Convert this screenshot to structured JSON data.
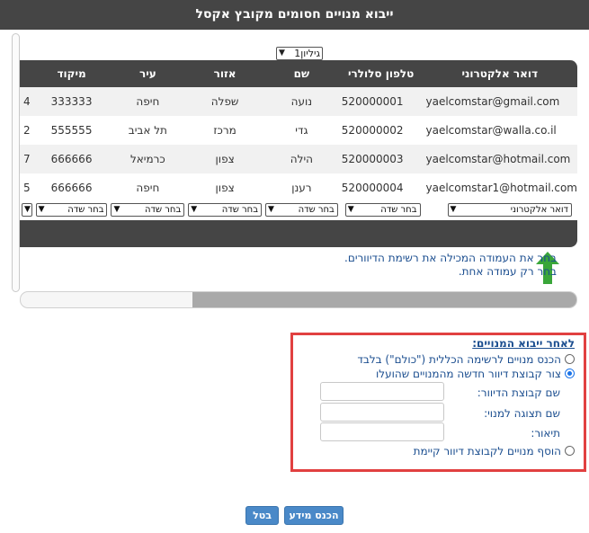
{
  "title": "ייבוא מנויים חסומים מקובץ אקסל",
  "sheet_select": {
    "value": "גיליון1"
  },
  "grid": {
    "headers": [
      "דואר אלקטרוני",
      "טלפון סלולרי",
      "שם",
      "אזור",
      "עיר",
      "מיקוד",
      ""
    ],
    "rows": [
      [
        "yaelcomstar@gmail.com",
        "520000001",
        "נועה",
        "שפלה",
        "חיפה",
        "333333",
        "4"
      ],
      [
        "yaelcomstar@walla.co.il",
        "520000002",
        "גדי",
        "מרכז",
        "תל אביב",
        "555555",
        "2"
      ],
      [
        "yaelcomstar@hotmail.com",
        "520000003",
        "הילה",
        "צפון",
        "כרמיאל",
        "666666",
        "7"
      ],
      [
        "yaelcomstar1@hotmail.com",
        "520000004",
        "רענן",
        "צפון",
        "חיפה",
        "666666",
        "5"
      ]
    ],
    "field_selects": [
      "דואר אלקטרוני",
      "בחר שדה",
      "בחר שדה",
      "בחר שדה",
      "בחר שדה",
      "בחר שדה",
      ""
    ]
  },
  "hint": {
    "line1": "בחר את העמודה המכילה את רשימת הדיוורים.",
    "line2": "בחר רק עמודה אחת."
  },
  "after_import": {
    "title": "לאחר ייבוא המנויים:",
    "option1": "הכנס מנויים לרשימה הכללית (\"כולם\") בלבד",
    "option2": "צור קבוצת דיוור חדשה מהמנויים שהועלו",
    "group_name_label": "שם קבוצת הדיוור:",
    "display_name_label": "שם תצוגה למנוי:",
    "description_label": "תיאור:",
    "option3": "הוסף מנויים לקבוצת דיוור קיימת"
  },
  "buttons": {
    "submit": "הכנס מידע",
    "cancel": "בטל"
  },
  "colors": {
    "header_bg": "#454545",
    "link_blue": "#1a4d8f",
    "highlight_border": "#e14040",
    "button": "#4a89c8",
    "arrow_green": "#3aa63a"
  }
}
